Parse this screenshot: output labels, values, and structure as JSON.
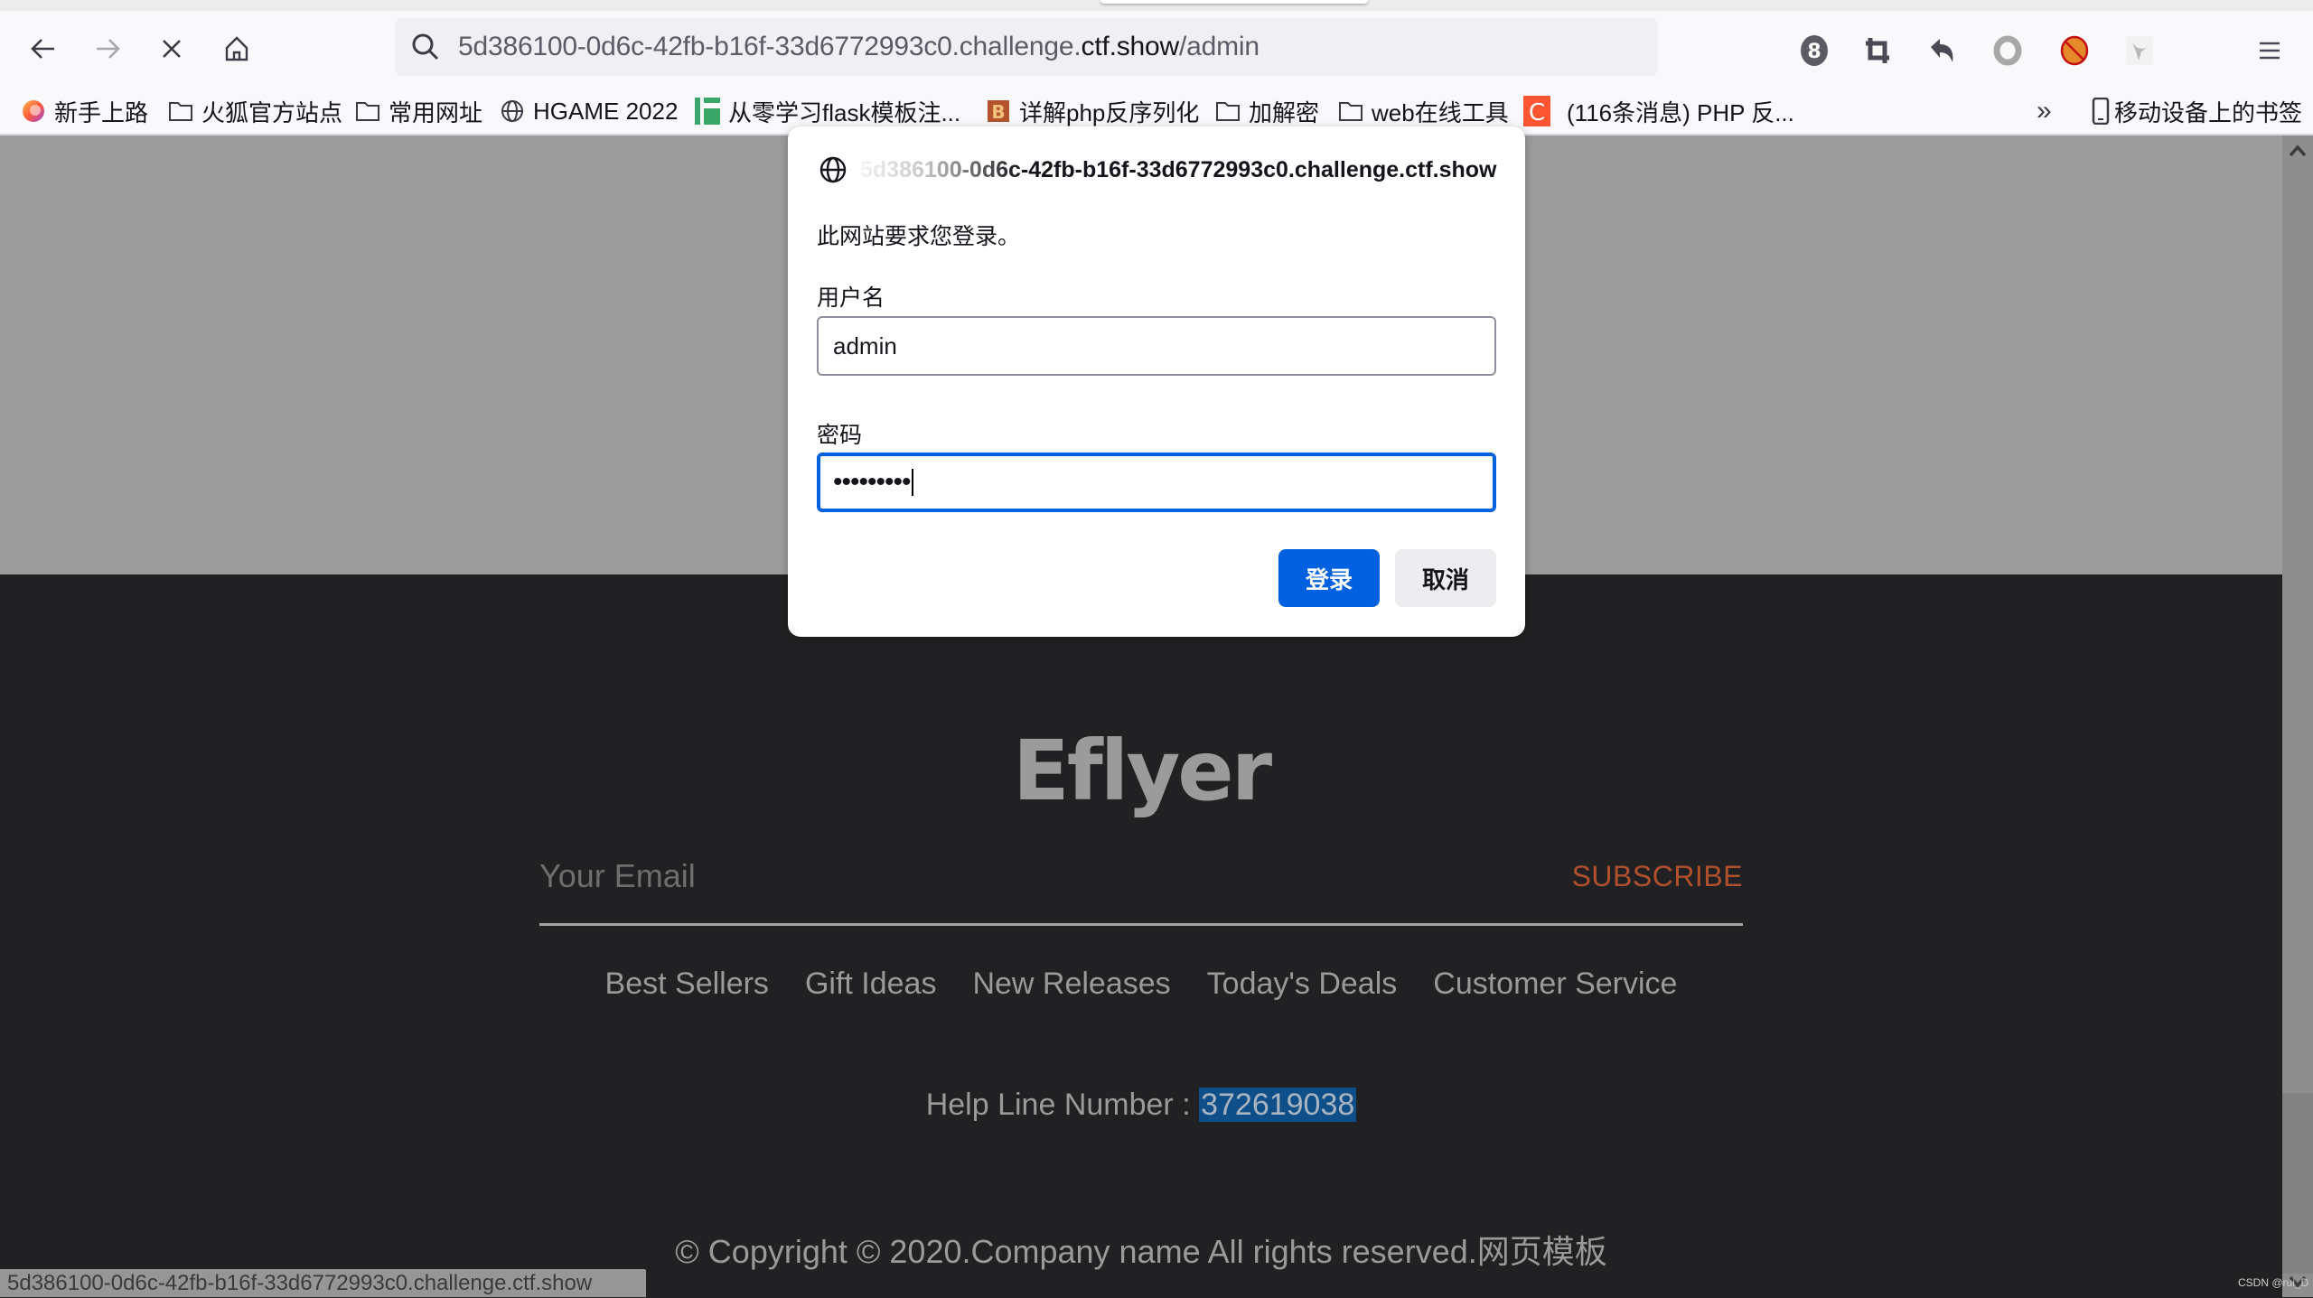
{
  "browser": {
    "url": {
      "prefix": "5d386100-0d6c-42fb-b16f-33d6772993c0.challenge.",
      "host": "ctf.show",
      "path": "/admin"
    },
    "toolbar_badge": "8",
    "bookmarks": [
      {
        "label": "新手上路",
        "icon": "firefox-icon"
      },
      {
        "label": "火狐官方站点",
        "icon": "folder-icon"
      },
      {
        "label": "常用网址",
        "icon": "folder-icon"
      },
      {
        "label": "HGAME 2022",
        "icon": "globe-icon"
      },
      {
        "label": "从零学习flask模板注...",
        "icon": "site-icon"
      },
      {
        "label": "详解php反序列化",
        "icon": "site-icon"
      },
      {
        "label": "加解密",
        "icon": "folder-icon"
      },
      {
        "label": "web在线工具",
        "icon": "folder-icon"
      },
      {
        "label": "(116条消息) PHP 反...",
        "icon": "csdn-icon"
      }
    ],
    "mobile_bookmarks": "移动设备上的书签",
    "overflow": "»",
    "status_url": "5d386100-0d6c-42fb-b16f-33d6772993c0.challenge.ctf.show"
  },
  "dialog": {
    "host_faded": "5d386100-0d6c",
    "host_rest": "-42fb-b16f-33d6772993c0.challenge.ctf.show",
    "message": "此网站要求您登录。",
    "username_label": "用户名",
    "username_value": "admin",
    "password_label": "密码",
    "password_masked": "•••••••••",
    "login_button": "登录",
    "cancel_button": "取消"
  },
  "page": {
    "logo": "Eflyer",
    "email_placeholder": "Your Email",
    "subscribe": "SUBSCRIBE",
    "links": [
      "Best Sellers",
      "Gift Ideas",
      "New Releases",
      "Today's Deals",
      "Customer Service"
    ],
    "helpline_label": "Help Line Number : ",
    "helpline_number": "372619038",
    "copyright": "© Copyright © 2020.Company name All rights reserved.网页模板"
  },
  "watermark": "CSDN @rui_D",
  "colors": {
    "accent": "#0061e0",
    "subscribe": "#b0502d",
    "selection": "#0e4f89"
  }
}
